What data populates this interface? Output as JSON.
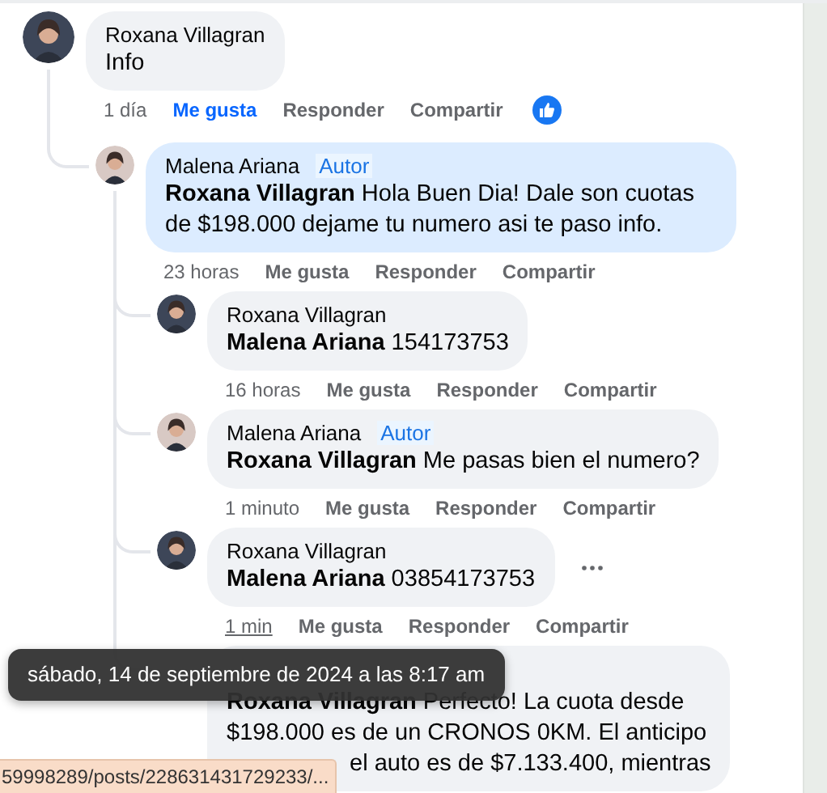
{
  "comments": [
    {
      "author": "Roxana Villagran",
      "color": "#3d4658",
      "highlighted": false,
      "body": "Info",
      "time": {
        "text": "1 día",
        "hovered": false
      },
      "like": {
        "label": "Me gusta",
        "liked": true
      },
      "reply": "Responder",
      "share": "Compartir",
      "reacted": true,
      "children": [
        {
          "author": "Malena Ariana",
          "badge": "Autor",
          "color": "#d8c9c4",
          "highlighted": true,
          "body": "**Roxana Villagran** Hola Buen Dia! Dale son cuotas de $198.000 dejame tu numero asi te paso info.",
          "time": {
            "text": "23 horas",
            "hovered": false
          },
          "like": {
            "label": "Me gusta",
            "liked": false
          },
          "reply": "Responder",
          "share": "Compartir",
          "children": [
            {
              "author": "Roxana Villagran",
              "color": "#3d4658",
              "highlighted": false,
              "body": "**Malena Ariana** 154173753",
              "time": {
                "text": "16 horas",
                "hovered": false
              },
              "like": {
                "label": "Me gusta",
                "liked": false
              },
              "reply": "Responder",
              "share": "Compartir"
            },
            {
              "author": "Malena Ariana",
              "badge": "Autor",
              "color": "#d8c9c4",
              "highlighted": false,
              "body": "**Roxana Villagran** Me pasas bien el numero?",
              "time": {
                "text": "1 minuto",
                "hovered": false
              },
              "like": {
                "label": "Me gusta",
                "liked": false
              },
              "reply": "Responder",
              "share": "Compartir"
            },
            {
              "author": "Roxana Villagran",
              "color": "#3d4658",
              "highlighted": false,
              "body": "**Malena Ariana** 03854173753",
              "time": {
                "text": "1 min",
                "hovered": true
              },
              "like": {
                "label": "Me gusta",
                "liked": false
              },
              "reply": "Responder",
              "share": "Compartir",
              "more_button": true
            },
            {
              "highlighted": false,
              "body_lines": [
                "**Roxana Villagran** Perfecto! La cuota desde",
                "$198.000 es de un CRONOS 0KM. El anticipo"
              ],
              "cut_line": "el auto es de $7.133.400, mientras"
            }
          ]
        }
      ]
    }
  ],
  "tooltip": "sábado, 14 de septiembre de 2024 a las 8:17 am",
  "status_bar": "59998289/posts/228631431729233/..."
}
